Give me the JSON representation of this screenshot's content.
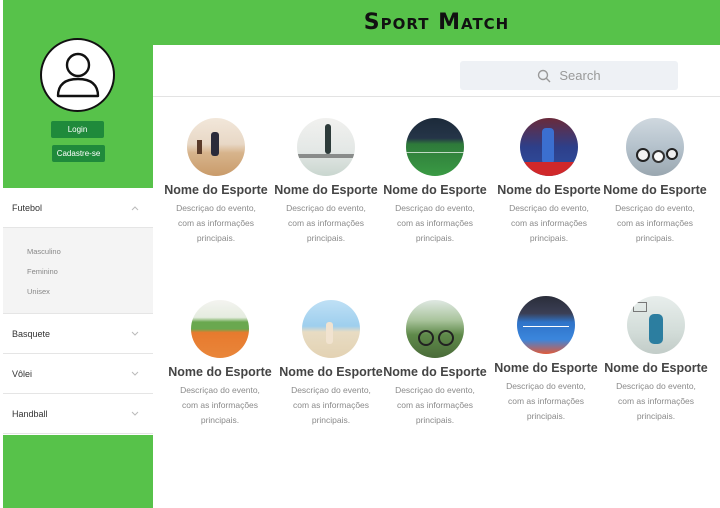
{
  "header": {
    "title": "Sport Match"
  },
  "search": {
    "placeholder": "Search"
  },
  "auth": {
    "login": "Login",
    "signup": "Cadastre-se"
  },
  "menu": {
    "futebol": "Futebol",
    "sub": [
      "Masculino",
      "Feminino",
      "Unisex"
    ],
    "basquete": "Basquete",
    "volei": "Vôlei",
    "handball": "Handball"
  },
  "cards": [
    {
      "name": "Nome do Esporte",
      "d1": "Descriçao do evento,",
      "d2": "com as informações",
      "d3": "principais."
    },
    {
      "name": "Nome do Esporte",
      "d1": "Descriçao do evento,",
      "d2": "com as informações",
      "d3": "principais."
    },
    {
      "name": "Nome do Esporte",
      "d1": "Descriçao do evento,",
      "d2": "com as informações",
      "d3": "principais."
    },
    {
      "name": "Nome do Esporte",
      "d1": "Descriçao do evento,",
      "d2": "com as informações",
      "d3": "principais."
    },
    {
      "name": "Nome do Esporte",
      "d1": "Descriçao do evento,",
      "d2": "com as informações",
      "d3": "principais."
    },
    {
      "name": "Nome do Esporte",
      "d1": "Descriçao do evento,",
      "d2": "com as informações",
      "d3": "principais."
    },
    {
      "name": "Nome do Esporte",
      "d1": "Descriçao do evento,",
      "d2": "com as informações",
      "d3": "principais."
    },
    {
      "name": "Nome do Esporte",
      "d1": "Descriçao do evento,",
      "d2": "com as informações",
      "d3": "principais."
    },
    {
      "name": "Nome do Esporte",
      "d1": "Descriçao do evento,",
      "d2": "com as informações",
      "d3": "principais."
    },
    {
      "name": "Nome do Esporte",
      "d1": "Descriçao do evento,",
      "d2": "com as informações",
      "d3": "principais."
    }
  ],
  "colors": {
    "brand_green": "#57c24a",
    "button_green": "#1f8a3b"
  }
}
